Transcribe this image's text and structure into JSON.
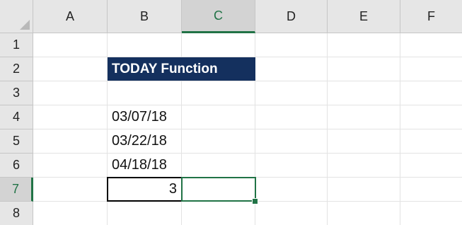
{
  "columns": [
    "A",
    "B",
    "C",
    "D",
    "E",
    "F"
  ],
  "rows": [
    "1",
    "2",
    "3",
    "4",
    "5",
    "6",
    "7",
    "8"
  ],
  "selected_column": "C",
  "selected_row": "7",
  "cells": {
    "B2": "TODAY Function",
    "B4": "03/07/18",
    "B5": "03/22/18",
    "B6": "04/18/18",
    "B7": "3",
    "C7": ""
  },
  "colors": {
    "title_fill": "#14305e",
    "title_text": "#ffffff",
    "selection_accent": "#217346"
  }
}
